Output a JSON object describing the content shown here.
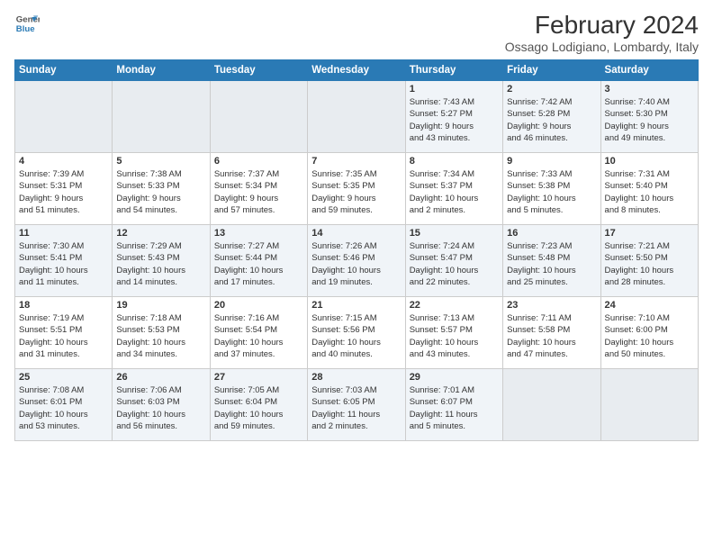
{
  "logo": {
    "line1": "General",
    "line2": "Blue"
  },
  "title": "February 2024",
  "location": "Ossago Lodigiano, Lombardy, Italy",
  "days_of_week": [
    "Sunday",
    "Monday",
    "Tuesday",
    "Wednesday",
    "Thursday",
    "Friday",
    "Saturday"
  ],
  "weeks": [
    {
      "days": [
        {
          "num": "",
          "empty": true,
          "text": ""
        },
        {
          "num": "",
          "empty": true,
          "text": ""
        },
        {
          "num": "",
          "empty": true,
          "text": ""
        },
        {
          "num": "",
          "empty": true,
          "text": ""
        },
        {
          "num": "1",
          "empty": false,
          "text": "Sunrise: 7:43 AM\nSunset: 5:27 PM\nDaylight: 9 hours\nand 43 minutes."
        },
        {
          "num": "2",
          "empty": false,
          "text": "Sunrise: 7:42 AM\nSunset: 5:28 PM\nDaylight: 9 hours\nand 46 minutes."
        },
        {
          "num": "3",
          "empty": false,
          "text": "Sunrise: 7:40 AM\nSunset: 5:30 PM\nDaylight: 9 hours\nand 49 minutes."
        }
      ]
    },
    {
      "days": [
        {
          "num": "4",
          "empty": false,
          "text": "Sunrise: 7:39 AM\nSunset: 5:31 PM\nDaylight: 9 hours\nand 51 minutes."
        },
        {
          "num": "5",
          "empty": false,
          "text": "Sunrise: 7:38 AM\nSunset: 5:33 PM\nDaylight: 9 hours\nand 54 minutes."
        },
        {
          "num": "6",
          "empty": false,
          "text": "Sunrise: 7:37 AM\nSunset: 5:34 PM\nDaylight: 9 hours\nand 57 minutes."
        },
        {
          "num": "7",
          "empty": false,
          "text": "Sunrise: 7:35 AM\nSunset: 5:35 PM\nDaylight: 9 hours\nand 59 minutes."
        },
        {
          "num": "8",
          "empty": false,
          "text": "Sunrise: 7:34 AM\nSunset: 5:37 PM\nDaylight: 10 hours\nand 2 minutes."
        },
        {
          "num": "9",
          "empty": false,
          "text": "Sunrise: 7:33 AM\nSunset: 5:38 PM\nDaylight: 10 hours\nand 5 minutes."
        },
        {
          "num": "10",
          "empty": false,
          "text": "Sunrise: 7:31 AM\nSunset: 5:40 PM\nDaylight: 10 hours\nand 8 minutes."
        }
      ]
    },
    {
      "days": [
        {
          "num": "11",
          "empty": false,
          "text": "Sunrise: 7:30 AM\nSunset: 5:41 PM\nDaylight: 10 hours\nand 11 minutes."
        },
        {
          "num": "12",
          "empty": false,
          "text": "Sunrise: 7:29 AM\nSunset: 5:43 PM\nDaylight: 10 hours\nand 14 minutes."
        },
        {
          "num": "13",
          "empty": false,
          "text": "Sunrise: 7:27 AM\nSunset: 5:44 PM\nDaylight: 10 hours\nand 17 minutes."
        },
        {
          "num": "14",
          "empty": false,
          "text": "Sunrise: 7:26 AM\nSunset: 5:46 PM\nDaylight: 10 hours\nand 19 minutes."
        },
        {
          "num": "15",
          "empty": false,
          "text": "Sunrise: 7:24 AM\nSunset: 5:47 PM\nDaylight: 10 hours\nand 22 minutes."
        },
        {
          "num": "16",
          "empty": false,
          "text": "Sunrise: 7:23 AM\nSunset: 5:48 PM\nDaylight: 10 hours\nand 25 minutes."
        },
        {
          "num": "17",
          "empty": false,
          "text": "Sunrise: 7:21 AM\nSunset: 5:50 PM\nDaylight: 10 hours\nand 28 minutes."
        }
      ]
    },
    {
      "days": [
        {
          "num": "18",
          "empty": false,
          "text": "Sunrise: 7:19 AM\nSunset: 5:51 PM\nDaylight: 10 hours\nand 31 minutes."
        },
        {
          "num": "19",
          "empty": false,
          "text": "Sunrise: 7:18 AM\nSunset: 5:53 PM\nDaylight: 10 hours\nand 34 minutes."
        },
        {
          "num": "20",
          "empty": false,
          "text": "Sunrise: 7:16 AM\nSunset: 5:54 PM\nDaylight: 10 hours\nand 37 minutes."
        },
        {
          "num": "21",
          "empty": false,
          "text": "Sunrise: 7:15 AM\nSunset: 5:56 PM\nDaylight: 10 hours\nand 40 minutes."
        },
        {
          "num": "22",
          "empty": false,
          "text": "Sunrise: 7:13 AM\nSunset: 5:57 PM\nDaylight: 10 hours\nand 43 minutes."
        },
        {
          "num": "23",
          "empty": false,
          "text": "Sunrise: 7:11 AM\nSunset: 5:58 PM\nDaylight: 10 hours\nand 47 minutes."
        },
        {
          "num": "24",
          "empty": false,
          "text": "Sunrise: 7:10 AM\nSunset: 6:00 PM\nDaylight: 10 hours\nand 50 minutes."
        }
      ]
    },
    {
      "days": [
        {
          "num": "25",
          "empty": false,
          "text": "Sunrise: 7:08 AM\nSunset: 6:01 PM\nDaylight: 10 hours\nand 53 minutes."
        },
        {
          "num": "26",
          "empty": false,
          "text": "Sunrise: 7:06 AM\nSunset: 6:03 PM\nDaylight: 10 hours\nand 56 minutes."
        },
        {
          "num": "27",
          "empty": false,
          "text": "Sunrise: 7:05 AM\nSunset: 6:04 PM\nDaylight: 10 hours\nand 59 minutes."
        },
        {
          "num": "28",
          "empty": false,
          "text": "Sunrise: 7:03 AM\nSunset: 6:05 PM\nDaylight: 11 hours\nand 2 minutes."
        },
        {
          "num": "29",
          "empty": false,
          "text": "Sunrise: 7:01 AM\nSunset: 6:07 PM\nDaylight: 11 hours\nand 5 minutes."
        },
        {
          "num": "",
          "empty": true,
          "text": ""
        },
        {
          "num": "",
          "empty": true,
          "text": ""
        }
      ]
    }
  ]
}
